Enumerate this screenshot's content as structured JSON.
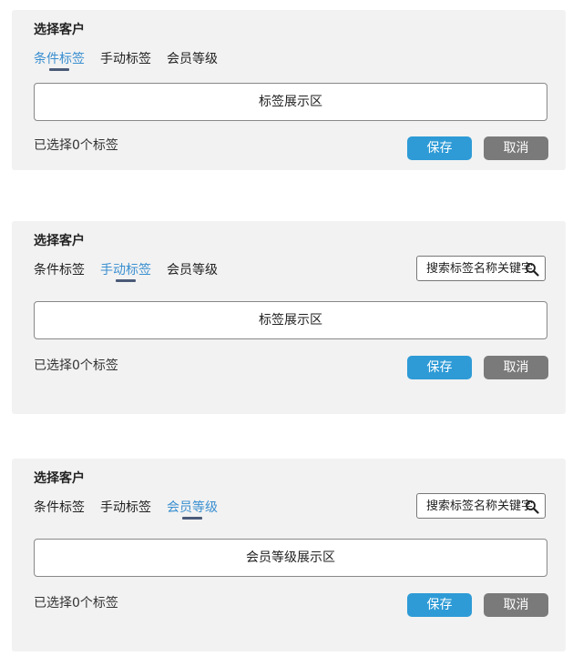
{
  "panels": [
    {
      "title": "选择客户",
      "tabs": [
        {
          "label": "条件标签"
        },
        {
          "label": "手动标签"
        },
        {
          "label": "会员等级"
        }
      ],
      "active_tab": 0,
      "tag_area_label": "标签展示区",
      "selected_count_text": "已选择0个标签",
      "save_label": "保存",
      "cancel_label": "取消"
    },
    {
      "title": "选择客户",
      "tabs": [
        {
          "label": "条件标签"
        },
        {
          "label": "手动标签"
        },
        {
          "label": "会员等级"
        }
      ],
      "active_tab": 1,
      "search_placeholder": "搜索标签名称关键字",
      "tag_area_label": "标签展示区",
      "selected_count_text": "已选择0个标签",
      "save_label": "保存",
      "cancel_label": "取消"
    },
    {
      "title": "选择客户",
      "tabs": [
        {
          "label": "条件标签"
        },
        {
          "label": "手动标签"
        },
        {
          "label": "会员等级"
        }
      ],
      "active_tab": 2,
      "search_placeholder": "搜索标签名称关键字",
      "tag_area_label": "会员等级展示区",
      "selected_count_text": "已选择0个标签",
      "save_label": "保存",
      "cancel_label": "取消"
    }
  ],
  "colors": {
    "panel_bg": "#f2f2f2",
    "accent_active_tab": "#3a8fd0",
    "tab_underline": "#4a5a78",
    "save_button": "#2e9bd6",
    "cancel_button": "#7a7a7a"
  },
  "icons": {
    "search": "search-icon"
  }
}
